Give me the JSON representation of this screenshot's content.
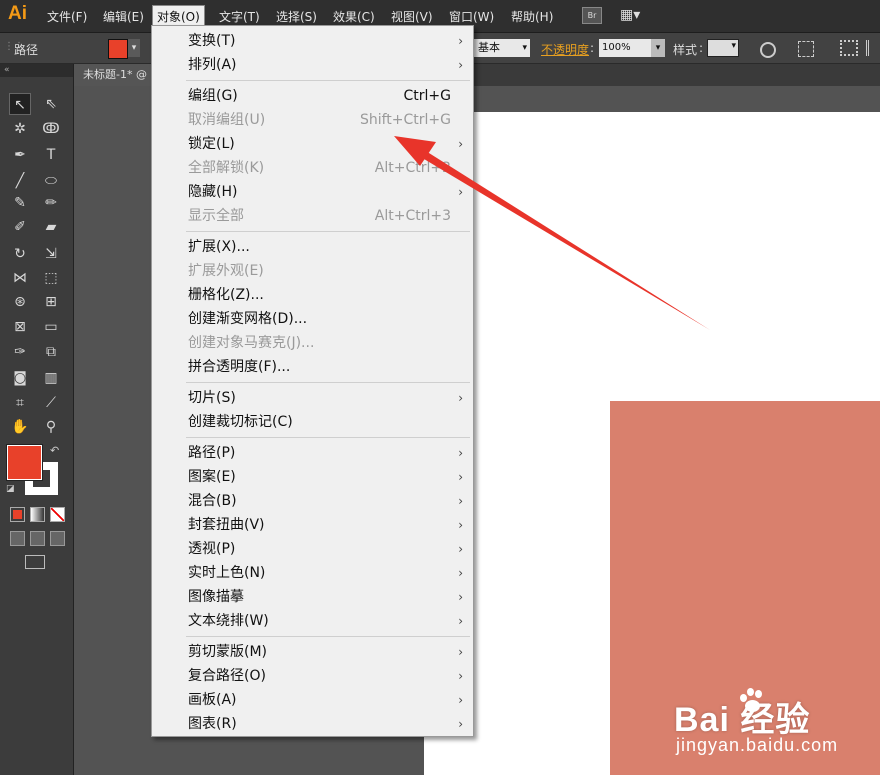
{
  "app": {
    "logo": "Ai"
  },
  "menubar": {
    "items": [
      "文件(F)",
      "编辑(E)",
      "对象(O)",
      "文字(T)",
      "选择(S)",
      "效果(C)",
      "视图(V)",
      "窗口(W)",
      "帮助(H)"
    ],
    "active": "对象(O)",
    "bridge_label": "Br"
  },
  "control_bar": {
    "selection_label": "路径",
    "stroke_style": "基本",
    "opacity_label": "不透明度",
    "opacity_value": "100%",
    "style_label": "样式",
    "fill_color": "#e8412a"
  },
  "document": {
    "tab_title": "未标题-1*",
    "shape_color": "#d9806d"
  },
  "object_menu": {
    "items": [
      {
        "label": "变换(T)",
        "shortcut": "",
        "submenu": true,
        "disabled": false
      },
      {
        "label": "排列(A)",
        "shortcut": "",
        "submenu": true,
        "disabled": false
      },
      {
        "label": "编组(G)",
        "shortcut": "Ctrl+G",
        "submenu": false,
        "disabled": false
      },
      {
        "label": "取消编组(U)",
        "shortcut": "Shift+Ctrl+G",
        "submenu": false,
        "disabled": true
      },
      {
        "label": "锁定(L)",
        "shortcut": "",
        "submenu": true,
        "disabled": false
      },
      {
        "label": "全部解锁(K)",
        "shortcut": "Alt+Ctrl+2",
        "submenu": false,
        "disabled": true
      },
      {
        "label": "隐藏(H)",
        "shortcut": "",
        "submenu": true,
        "disabled": false
      },
      {
        "label": "显示全部",
        "shortcut": "Alt+Ctrl+3",
        "submenu": false,
        "disabled": true
      },
      {
        "label": "扩展(X)...",
        "shortcut": "",
        "submenu": false,
        "disabled": false
      },
      {
        "label": "扩展外观(E)",
        "shortcut": "",
        "submenu": false,
        "disabled": true
      },
      {
        "label": "栅格化(Z)...",
        "shortcut": "",
        "submenu": false,
        "disabled": false
      },
      {
        "label": "创建渐变网格(D)...",
        "shortcut": "",
        "submenu": false,
        "disabled": false
      },
      {
        "label": "创建对象马赛克(J)...",
        "shortcut": "",
        "submenu": false,
        "disabled": true
      },
      {
        "label": "拼合透明度(F)...",
        "shortcut": "",
        "submenu": false,
        "disabled": false
      },
      {
        "label": "切片(S)",
        "shortcut": "",
        "submenu": true,
        "disabled": false
      },
      {
        "label": "创建裁切标记(C)",
        "shortcut": "",
        "submenu": false,
        "disabled": false
      },
      {
        "label": "路径(P)",
        "shortcut": "",
        "submenu": true,
        "disabled": false
      },
      {
        "label": "图案(E)",
        "shortcut": "",
        "submenu": true,
        "disabled": false
      },
      {
        "label": "混合(B)",
        "shortcut": "",
        "submenu": true,
        "disabled": false
      },
      {
        "label": "封套扭曲(V)",
        "shortcut": "",
        "submenu": true,
        "disabled": false
      },
      {
        "label": "透视(P)",
        "shortcut": "",
        "submenu": true,
        "disabled": false
      },
      {
        "label": "实时上色(N)",
        "shortcut": "",
        "submenu": true,
        "disabled": false
      },
      {
        "label": "图像描摹",
        "shortcut": "",
        "submenu": true,
        "disabled": false
      },
      {
        "label": "文本绕排(W)",
        "shortcut": "",
        "submenu": true,
        "disabled": false
      },
      {
        "label": "剪切蒙版(M)",
        "shortcut": "",
        "submenu": true,
        "disabled": false
      },
      {
        "label": "复合路径(O)",
        "shortcut": "",
        "submenu": true,
        "disabled": false
      },
      {
        "label": "画板(A)",
        "shortcut": "",
        "submenu": true,
        "disabled": false
      },
      {
        "label": "图表(R)",
        "shortcut": "",
        "submenu": true,
        "disabled": false
      }
    ]
  },
  "watermark": {
    "brand": "Bai  经验",
    "url": "jingyan.baidu.com"
  },
  "annotation": {
    "arrow_color": "#e8342a"
  }
}
